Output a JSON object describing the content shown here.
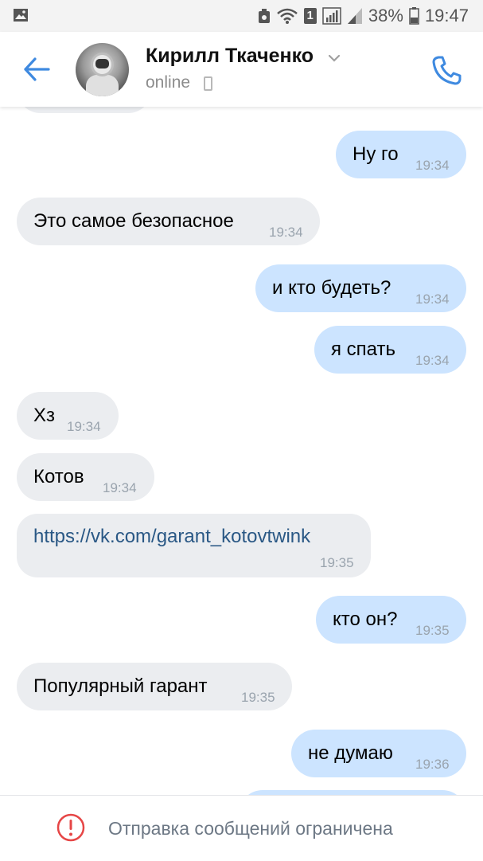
{
  "status_bar": {
    "battery": "38%",
    "time": "19:47",
    "sim_badge": "1"
  },
  "header": {
    "contact_name": "Кирилл Ткаченко",
    "status": "online"
  },
  "messages": [
    {
      "dir": "out",
      "text": "Ну го",
      "time": "19:34"
    },
    {
      "dir": "in",
      "text": "Это самое безопасное",
      "time": "19:34"
    },
    {
      "dir": "out",
      "text": "и кто будеть?",
      "time": "19:34"
    },
    {
      "dir": "out",
      "text": "я спать",
      "time": "19:34"
    },
    {
      "dir": "in",
      "text": "Хз",
      "time": "19:34"
    },
    {
      "dir": "in",
      "text": "Котов",
      "time": "19:34"
    },
    {
      "dir": "in",
      "text": "https://vk.com/garant_kotovtwink",
      "time": "19:35"
    },
    {
      "dir": "out",
      "text": "кто он?",
      "time": "19:35"
    },
    {
      "dir": "in",
      "text": "Популярный гарант",
      "time": "19:35"
    },
    {
      "dir": "out",
      "text": "не думаю",
      "time": "19:36"
    }
  ],
  "footer": {
    "notice": "Отправка сообщений ограничена"
  },
  "colors": {
    "accent": "#3f8ae0",
    "incoming_bubble": "#ebedf0",
    "outgoing_bubble": "#cce4ff",
    "warning": "#e64646"
  }
}
